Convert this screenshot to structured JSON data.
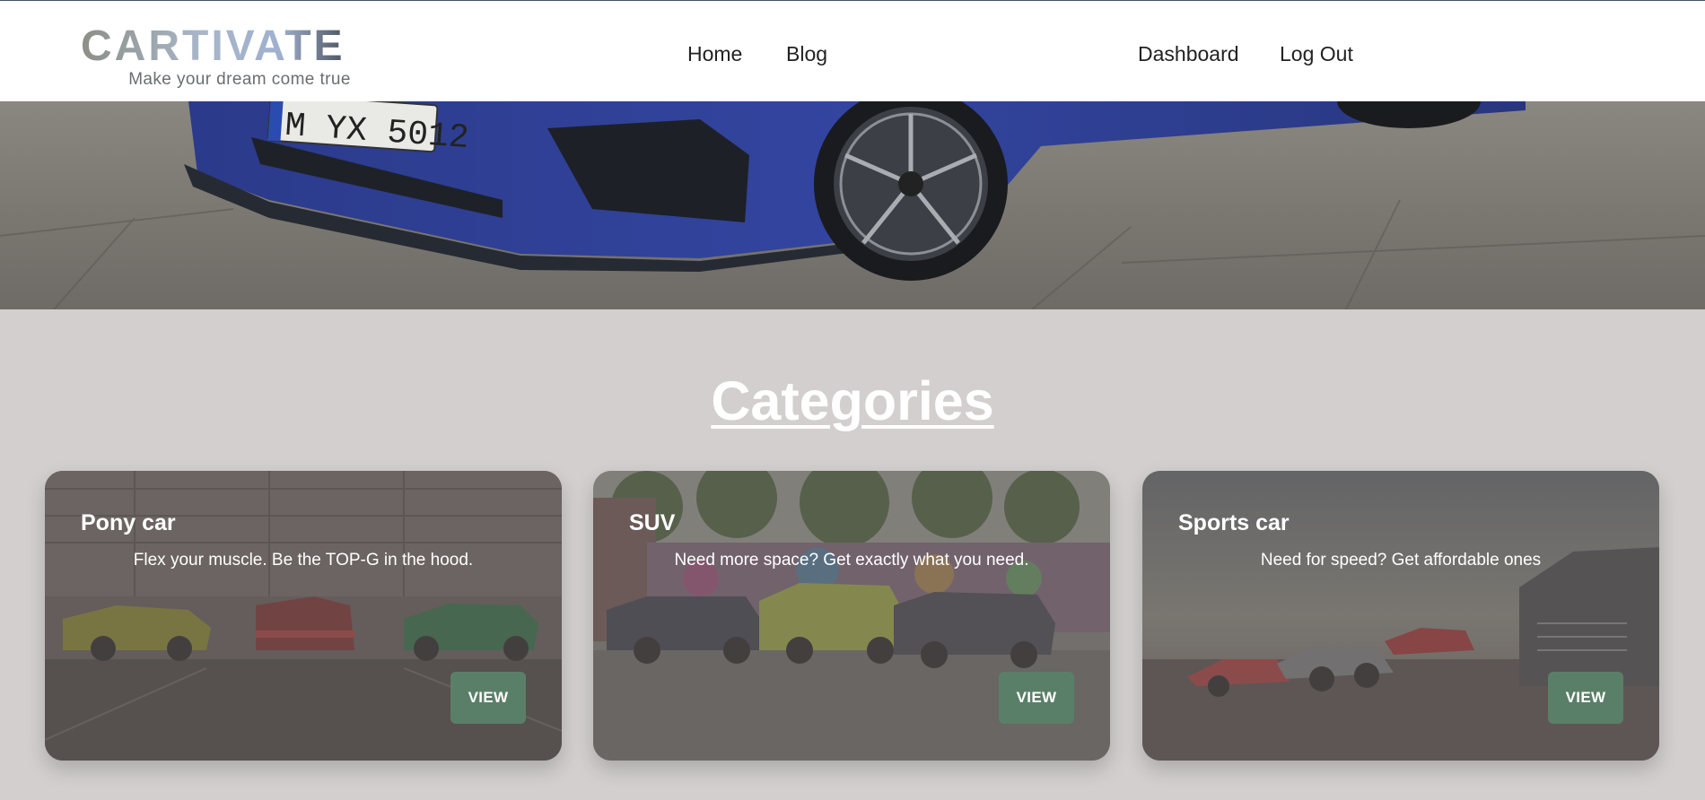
{
  "brand": {
    "logo_text": "CARTIVATE",
    "tagline": "Make your dream come true"
  },
  "nav": {
    "left": [
      {
        "label": "Home"
      },
      {
        "label": "Blog"
      }
    ],
    "right": [
      {
        "label": "Dashboard"
      },
      {
        "label": "Log Out"
      }
    ]
  },
  "hero": {
    "plate_text": "M YX 5012"
  },
  "categories": {
    "title": "Categories",
    "cards": [
      {
        "title": "Pony car",
        "description": "Flex your muscle. Be the TOP-G in the hood.",
        "button": "VIEW"
      },
      {
        "title": "SUV",
        "description": "Need more space? Get exactly what you need.",
        "button": "VIEW"
      },
      {
        "title": "Sports car",
        "description": "Need for speed? Get affordable ones",
        "button": "VIEW"
      }
    ]
  },
  "colors": {
    "page_bg": "#d2cfce",
    "header_bg": "#ffffff",
    "button_green": "#5a7f68",
    "logo_grey": "#8f948f",
    "logo_blue": "#9fb1cf",
    "logo_dark": "#5f6670"
  }
}
